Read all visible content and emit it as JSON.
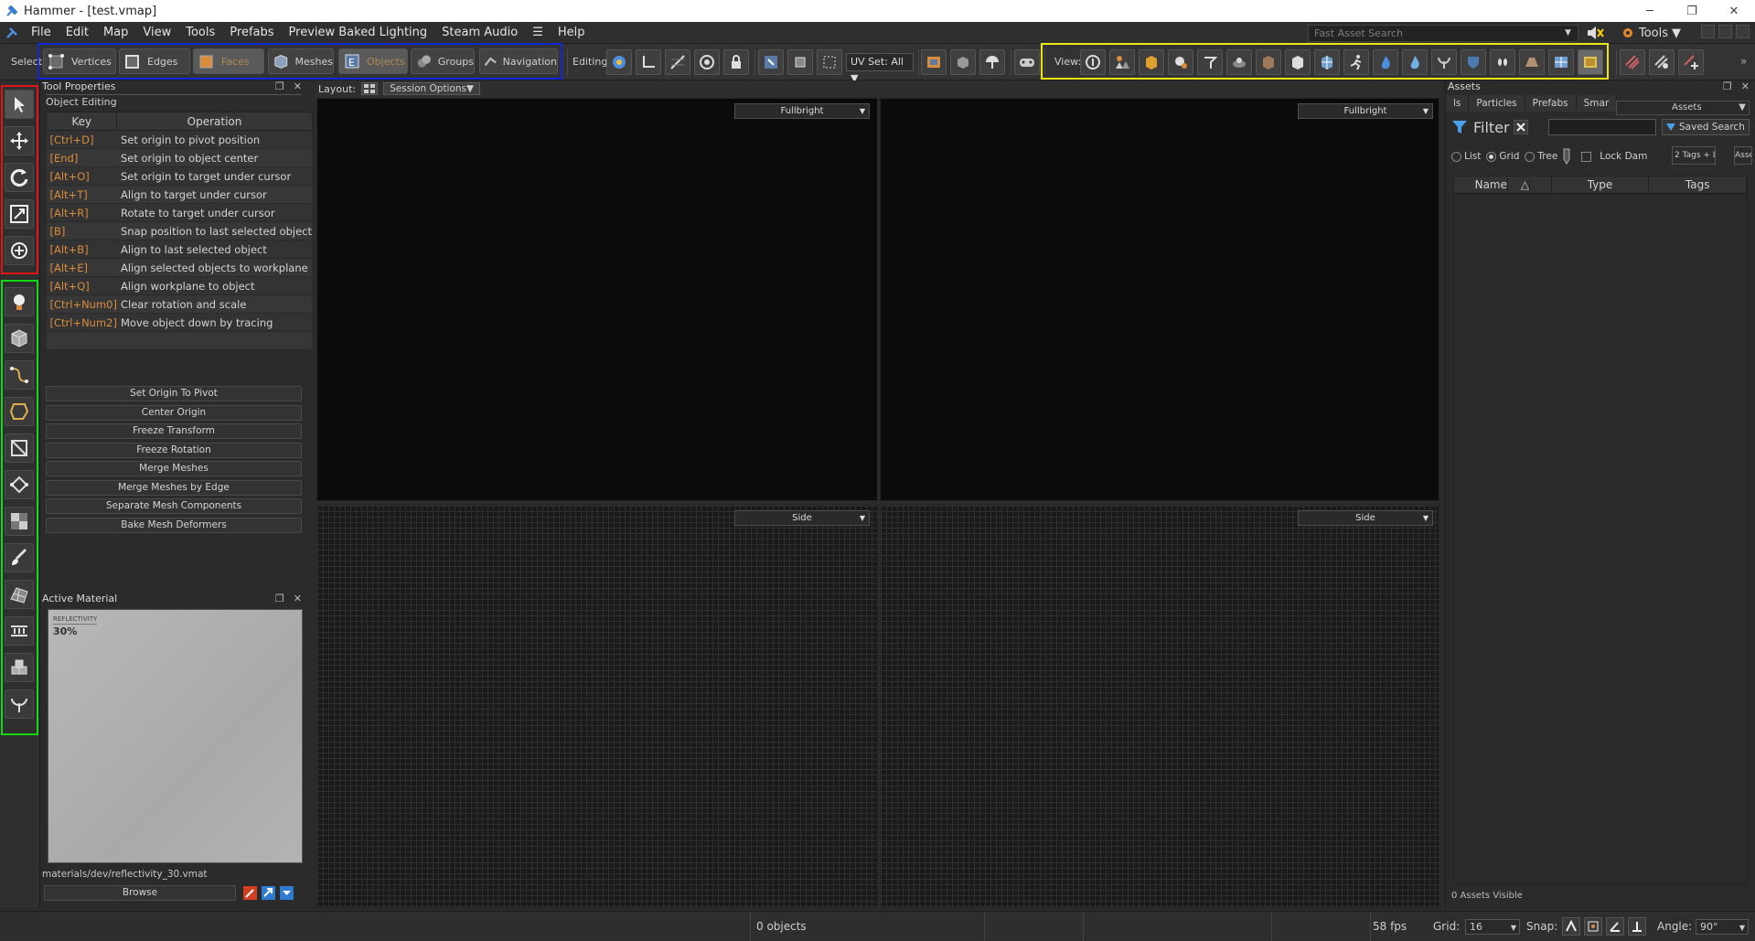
{
  "window": {
    "title": "Hammer - [test.vmap]",
    "minimize": "─",
    "maximize": "❐",
    "close": "✕"
  },
  "menu": {
    "items": [
      "File",
      "Edit",
      "Map",
      "View",
      "Tools",
      "Prefabs",
      "Preview Baked Lighting",
      "Steam Audio",
      "☰",
      "Help"
    ],
    "fast_search_placeholder": "Fast Asset Search",
    "tools_label": "Tools"
  },
  "toolbar": {
    "select_label": "Select",
    "modes": [
      "Vertices",
      "Edges",
      "Faces",
      "Meshes",
      "Objects",
      "Groups",
      "Navigation"
    ],
    "editing_label": "Editing:",
    "uv_set": "UV Set: All",
    "view_label": "View:"
  },
  "tool_properties": {
    "title": "Tool Properties",
    "section": "Object Editing",
    "col_key": "Key",
    "col_operation": "Operation",
    "rows": [
      {
        "key": "[Ctrl+D]",
        "op": "Set origin to pivot position"
      },
      {
        "key": "[End]",
        "op": "Set origin to object center"
      },
      {
        "key": "[Alt+O]",
        "op": "Set origin to target under cursor"
      },
      {
        "key": "[Alt+T]",
        "op": "Align to target under cursor"
      },
      {
        "key": "[Alt+R]",
        "op": "Rotate to target under cursor"
      },
      {
        "key": "[B]",
        "op": "Snap position to last selected object"
      },
      {
        "key": "[Alt+B]",
        "op": "Align to last selected object"
      },
      {
        "key": "[Alt+E]",
        "op": "Align selected objects to workplane"
      },
      {
        "key": "[Alt+Q]",
        "op": "Align workplane to object"
      },
      {
        "key": "[Ctrl+Num0]",
        "op": "Clear rotation and scale"
      },
      {
        "key": "[Ctrl+Num2]",
        "op": "Move object down by tracing"
      }
    ],
    "buttons": [
      "Set Origin To Pivot",
      "Center Origin",
      "Freeze Transform",
      "Freeze Rotation",
      "Merge Meshes",
      "Merge Meshes by Edge",
      "Separate Mesh Components",
      "Bake Mesh Deformers"
    ]
  },
  "active_material": {
    "title": "Active Material",
    "thumb_label": "REFLECTIVITY",
    "thumb_value": "30%",
    "path": "materials/dev/reflectivity_30.vmat",
    "browse": "Browse"
  },
  "viewports": {
    "layout_label": "Layout:",
    "session_options": "Session Options",
    "top_left": "Fullbright",
    "top_right": "Fullbright",
    "bottom_left": "Side",
    "bottom_right": "Side"
  },
  "assets": {
    "title": "Assets",
    "tabs": [
      "ls",
      "Particles",
      "Prefabs",
      "Smar"
    ],
    "dropdown": "Assets",
    "filter": "Filter",
    "saved_search": "Saved Search",
    "list": "List",
    "grid": "Grid",
    "tree": "Tree",
    "lock_dam": "Lock Dam",
    "tags_btn": "2 Tags + L",
    "asse_btn": "Asse",
    "col_name": "Name",
    "col_type": "Type",
    "col_tags": "Tags",
    "visible": "0 Assets Visible"
  },
  "status": {
    "objects": "0 objects",
    "fps": "58 fps",
    "grid_label": "Grid:",
    "grid_value": "16",
    "snap_label": "Snap:",
    "angle_label": "Angle:",
    "angle_value": "90°"
  },
  "colors": {
    "accent_orange": "#d98c3e",
    "highlight_blue": "#1028d8",
    "highlight_yellow": "#ece614",
    "highlight_red": "#e01515",
    "highlight_green": "#14d814"
  }
}
